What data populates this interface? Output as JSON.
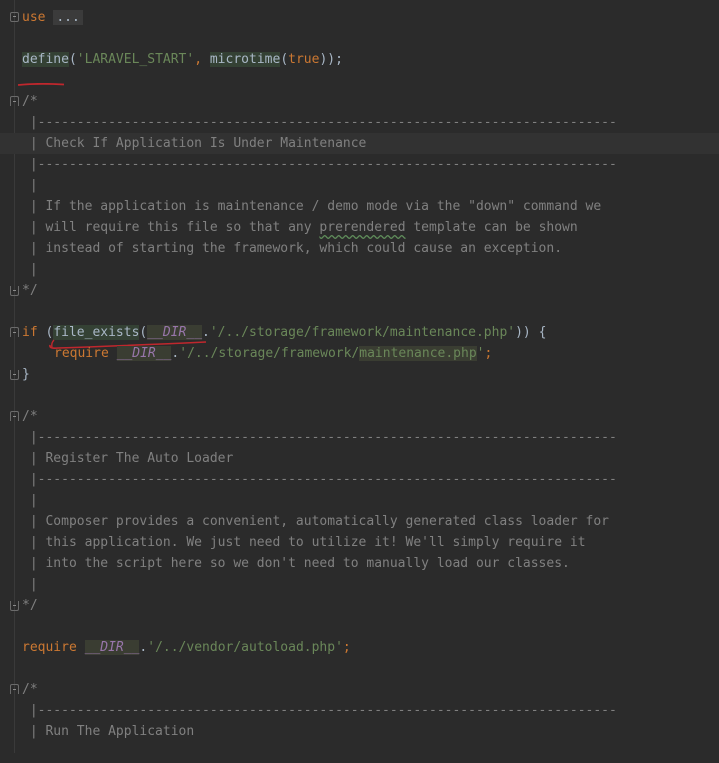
{
  "editor": {
    "lines": {
      "use_kw": "use",
      "use_fold": "...",
      "define_fn": "define",
      "define_open": "(",
      "define_str": "'LARAVEL_START'",
      "define_comma": ", ",
      "microtime_fn": "microtime",
      "microtime_open": "(",
      "true_kw": "true",
      "define_close": "));",
      "c1_start": "/*",
      "c1_dash1": " |--------------------------------------------------------------------------",
      "c1_title": " | Check If Application Is Under Maintenance",
      "c1_dash2": " |--------------------------------------------------------------------------",
      "c1_bar1": " |",
      "c1_text1": " | If the application is maintenance / demo mode via the \"down\" command we",
      "c1_text2a": " | will require this file so that any ",
      "c1_text2b": "prerendered",
      "c1_text2c": " template can be shown",
      "c1_text3": " | instead of starting the framework, which could cause an exception.",
      "c1_bar2": " |",
      "c1_end": "*/",
      "if_kw": "if",
      "if_open": " (",
      "file_exists": "file_exists",
      "fe_open": "(",
      "dir1": "__DIR__",
      "dot1": ".",
      "path1": "'/../storage/framework/maintenance.php'",
      "if_close": ")) {",
      "require_kw": "require",
      "dir2": "__DIR__",
      "dot2": ".",
      "path2a": "'/../storage/framework/",
      "path2b": "maintenance.php",
      "path2c": "'",
      "semi2": ";",
      "brace_close": "}",
      "c2_start": "/*",
      "c2_dash1": " |--------------------------------------------------------------------------",
      "c2_title": " | Register The Auto Loader",
      "c2_dash2": " |--------------------------------------------------------------------------",
      "c2_bar1": " |",
      "c2_text1": " | Composer provides a convenient, automatically generated class loader for",
      "c2_text2": " | this application. We just need to utilize it! We'll simply require it",
      "c2_text3": " | into the script here so we don't need to manually load our classes.",
      "c2_bar2": " |",
      "c2_end": "*/",
      "require2_kw": "require",
      "dir3": "__DIR__",
      "dot3": ".",
      "path3": "'/../vendor/autoload.php'",
      "semi3": ";",
      "c3_start": "/*",
      "c3_dash1": " |--------------------------------------------------------------------------",
      "c3_title": " | Run The Application"
    }
  },
  "icons": [
    "fold-collapsed-icon",
    "fold-open-icon",
    "fold-close-icon"
  ],
  "colors": {
    "background": "#2b2b2b",
    "keyword": "#cc7832",
    "function": "#ffc66d",
    "string": "#6a8759",
    "comment": "#808080",
    "magic_constant": "#9876aa",
    "annotation_red": "#c0272d"
  }
}
